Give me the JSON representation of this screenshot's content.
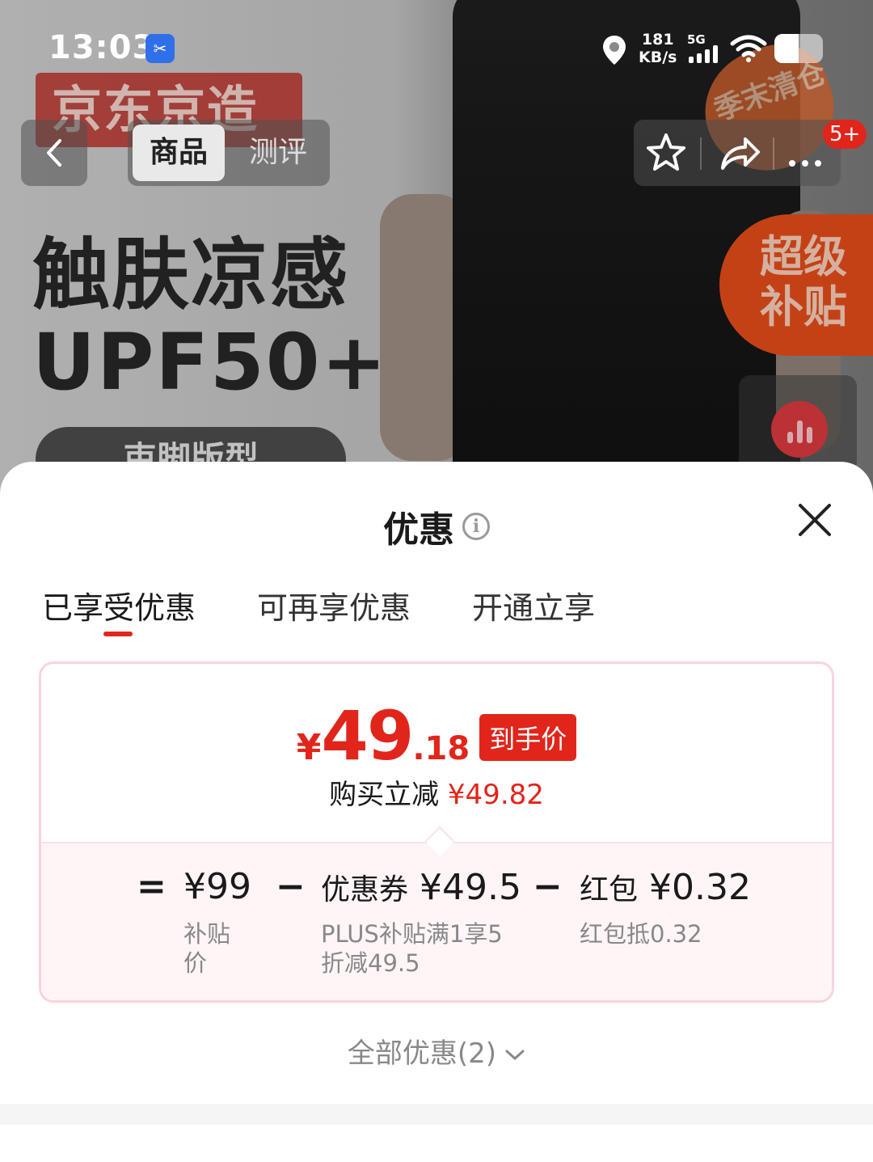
{
  "status_bar": {
    "time": "13:03",
    "speed_value": "181",
    "speed_unit": "KB/s",
    "network": "5G"
  },
  "hero": {
    "brand_text": "京东京造",
    "slogan_line1": "触肤凉感",
    "slogan_line2": "UPF50+",
    "pill_text": "束脚版型",
    "season_badge": "季末清仓",
    "subsidy_badge_line1": "超级",
    "subsidy_badge_line2": "补贴"
  },
  "top_nav": {
    "tabs": [
      {
        "label": "商品",
        "active": true
      },
      {
        "label": "测评",
        "active": false
      }
    ],
    "notification_badge": "5+",
    "icons": [
      "back-icon",
      "star-icon",
      "share-icon",
      "more-icon"
    ]
  },
  "sheet": {
    "title": "优惠",
    "info_icon_glyph": "i",
    "tabs": [
      {
        "label": "已享受优惠",
        "active": true
      },
      {
        "label": "可再享优惠",
        "active": false
      },
      {
        "label": "开通立享",
        "active": false
      }
    ],
    "final_price": {
      "currency": "¥",
      "integer": "49",
      "decimal": ".18",
      "tag": "到手价"
    },
    "saved": {
      "label": "购买立减",
      "amount": "¥49.82"
    },
    "formula": {
      "equals": "=",
      "minus": "−",
      "items": [
        {
          "label": "",
          "amount": "¥99",
          "sub": [
            "补贴",
            "价"
          ]
        },
        {
          "label": "优惠券",
          "amount": "¥49.5",
          "sub": [
            "PLUS补贴满1享5",
            "折减49.5"
          ]
        },
        {
          "label": "红包",
          "amount": "¥0.32",
          "sub": [
            "红包抵0.32"
          ]
        }
      ]
    },
    "all_offers": "全部优惠(2)",
    "next_section_title": "可再享优惠"
  },
  "colors": {
    "accent": "#e1251b",
    "card_border": "#fbd3dc",
    "card_lower_bg": "#fff5f7"
  }
}
